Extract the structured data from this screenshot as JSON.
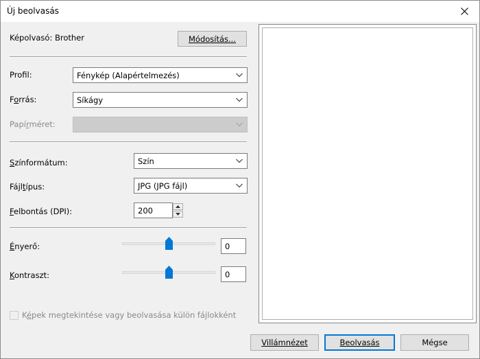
{
  "window": {
    "title": "Új beolvasás",
    "close_icon": "close-icon"
  },
  "scanner": {
    "label": "Képolvasó: Brother",
    "change_button": "Módosítás..."
  },
  "profile": {
    "label_pre": "Prof",
    "label_accel": "i",
    "label_post": "l:",
    "value": "Fénykép (Alapértelmezés)"
  },
  "source": {
    "label_pre": "F",
    "label_accel": "o",
    "label_post": "rrás:",
    "value": "Síkágy"
  },
  "paper_size": {
    "label_pre": "Papí",
    "label_accel": "r",
    "label_post": "méret:",
    "value": ""
  },
  "color_format": {
    "label_accel": "S",
    "label_post": "zínformátum:",
    "value": "Szín"
  },
  "file_type": {
    "label_pre": "Fájl",
    "label_accel": "t",
    "label_post": "ípus:",
    "value": "JPG (JPG fájl)"
  },
  "resolution": {
    "label_accel": "F",
    "label_post": "elbontás (DPI):",
    "value": "200"
  },
  "brightness": {
    "label_pre": "",
    "label_accel": "É",
    "label_post": "nyerő:",
    "value": "0",
    "level": 0
  },
  "contrast": {
    "label_accel": "K",
    "label_post": "ontraszt:",
    "value": "0",
    "level": 0
  },
  "separate_files": {
    "label_pre": "K",
    "label_accel": "é",
    "label_post": "pek megtekintése vagy beolvasása külön fájlokként",
    "checked": false
  },
  "buttons": {
    "preview": "Villámnézet",
    "scan": "Beolvasás",
    "cancel": "Mégse"
  },
  "colors": {
    "accent": "#0078d7",
    "window_bg": "#f0f0f0"
  }
}
